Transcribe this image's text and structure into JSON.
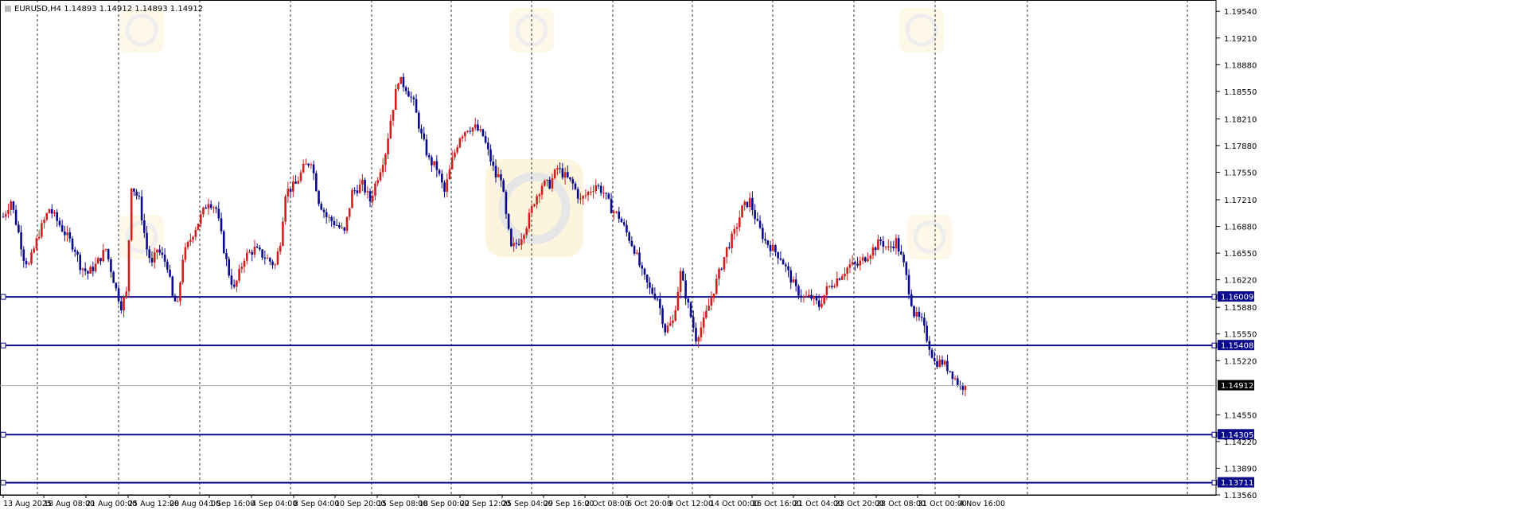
{
  "chart_data": {
    "type": "candlestick",
    "title": "EURUSD,H4  1.14893 1.14912 1.14893 1.14912",
    "last_price": 1.14912,
    "ylim": [
      1.1356,
      1.1968
    ],
    "y_ticks": [
      "1.19540",
      "1.19210",
      "1.18880",
      "1.18550",
      "1.18210",
      "1.17880",
      "1.17550",
      "1.17210",
      "1.16880",
      "1.16550",
      "1.16220",
      "1.15880",
      "1.15550",
      "1.15220",
      "1.14912",
      "1.14550",
      "1.14220",
      "1.13890",
      "1.13560"
    ],
    "x_labels": [
      "13 Aug 2025",
      "18 Aug 08:00",
      "21 Aug 00:00",
      "25 Aug 12:00",
      "28 Aug 04:00",
      "1 Sep 16:00",
      "4 Sep 04:00",
      "8 Sep 04:00",
      "10 Sep 20:00",
      "15 Sep 08:00",
      "18 Sep 00:00",
      "22 Sep 12:00",
      "25 Sep 04:00",
      "29 Sep 16:00",
      "2 Oct 08:00",
      "6 Oct 20:00",
      "9 Oct 12:00",
      "14 Oct 00:00",
      "16 Oct 16:00",
      "21 Oct 04:00",
      "23 Oct 20:00",
      "28 Oct 08:00",
      "31 Oct 00:00",
      "4 Nov 16:00"
    ],
    "horizontal_levels": [
      {
        "value": 1.16009,
        "label": "1.16009"
      },
      {
        "value": 1.15408,
        "label": "1.15408"
      },
      {
        "value": 1.14305,
        "label": "1.14305"
      },
      {
        "value": 1.13711,
        "label": "1.13711"
      }
    ],
    "price_path": [
      [
        0,
        1.17
      ],
      [
        3,
        1.172
      ],
      [
        6,
        1.168
      ],
      [
        8,
        1.165
      ],
      [
        10,
        1.164
      ],
      [
        14,
        1.168
      ],
      [
        18,
        1.171
      ],
      [
        20,
        1.17
      ],
      [
        24,
        1.168
      ],
      [
        28,
        1.166
      ],
      [
        30,
        1.164
      ],
      [
        33,
        1.163
      ],
      [
        36,
        1.164
      ],
      [
        40,
        1.166
      ],
      [
        44,
        1.161
      ],
      [
        46,
        1.159
      ],
      [
        48,
        1.1605
      ],
      [
        50,
        1.174
      ],
      [
        53,
        1.172
      ],
      [
        56,
        1.166
      ],
      [
        58,
        1.164
      ],
      [
        60,
        1.166
      ],
      [
        64,
        1.164
      ],
      [
        66,
        1.16
      ],
      [
        68,
        1.159
      ],
      [
        70,
        1.165
      ],
      [
        74,
        1.168
      ],
      [
        77,
        1.17
      ],
      [
        80,
        1.172
      ],
      [
        83,
        1.171
      ],
      [
        86,
        1.166
      ],
      [
        88,
        1.163
      ],
      [
        90,
        1.161
      ],
      [
        94,
        1.165
      ],
      [
        98,
        1.166
      ],
      [
        102,
        1.165
      ],
      [
        106,
        1.164
      ],
      [
        108,
        1.167
      ],
      [
        110,
        1.173
      ],
      [
        114,
        1.174
      ],
      [
        117,
        1.176
      ],
      [
        120,
        1.177
      ],
      [
        123,
        1.172
      ],
      [
        126,
        1.17
      ],
      [
        130,
        1.169
      ],
      [
        133,
        1.168
      ],
      [
        136,
        1.173
      ],
      [
        140,
        1.174
      ],
      [
        143,
        1.172
      ],
      [
        146,
        1.175
      ],
      [
        149,
        1.178
      ],
      [
        151,
        1.182
      ],
      [
        154,
        1.187
      ],
      [
        157,
        1.186
      ],
      [
        160,
        1.184
      ],
      [
        163,
        1.18
      ],
      [
        166,
        1.177
      ],
      [
        169,
        1.176
      ],
      [
        172,
        1.173
      ],
      [
        175,
        1.177
      ],
      [
        178,
        1.18
      ],
      [
        181,
        1.181
      ],
      [
        184,
        1.181
      ],
      [
        187,
        1.18
      ],
      [
        190,
        1.177
      ],
      [
        192,
        1.175
      ],
      [
        194,
        1.175
      ],
      [
        196,
        1.17
      ],
      [
        198,
        1.166
      ],
      [
        201,
        1.167
      ],
      [
        204,
        1.169
      ],
      [
        207,
        1.172
      ],
      [
        210,
        1.174
      ],
      [
        213,
        1.174
      ],
      [
        216,
        1.176
      ],
      [
        219,
        1.175
      ],
      [
        222,
        1.174
      ],
      [
        225,
        1.172
      ],
      [
        228,
        1.173
      ],
      [
        231,
        1.174
      ],
      [
        234,
        1.173
      ],
      [
        237,
        1.171
      ],
      [
        240,
        1.17
      ],
      [
        243,
        1.168
      ],
      [
        246,
        1.166
      ],
      [
        249,
        1.163
      ],
      [
        252,
        1.161
      ],
      [
        255,
        1.16
      ],
      [
        258,
        1.156
      ],
      [
        261,
        1.157
      ],
      [
        264,
        1.163
      ],
      [
        267,
        1.159
      ],
      [
        270,
        1.155
      ],
      [
        273,
        1.157
      ],
      [
        276,
        1.16
      ],
      [
        279,
        1.163
      ],
      [
        282,
        1.166
      ],
      [
        285,
        1.168
      ],
      [
        288,
        1.171
      ],
      [
        291,
        1.172
      ],
      [
        294,
        1.169
      ],
      [
        297,
        1.167
      ],
      [
        300,
        1.166
      ],
      [
        303,
        1.165
      ],
      [
        306,
        1.163
      ],
      [
        309,
        1.161
      ],
      [
        312,
        1.16
      ],
      [
        315,
        1.16
      ],
      [
        318,
        1.159
      ],
      [
        321,
        1.161
      ],
      [
        324,
        1.162
      ],
      [
        327,
        1.163
      ],
      [
        330,
        1.164
      ],
      [
        333,
        1.164
      ],
      [
        336,
        1.165
      ],
      [
        339,
        1.166
      ],
      [
        342,
        1.167
      ],
      [
        345,
        1.166
      ],
      [
        348,
        1.167
      ],
      [
        351,
        1.164
      ],
      [
        353,
        1.161
      ],
      [
        355,
        1.158
      ],
      [
        358,
        1.157
      ],
      [
        360,
        1.155
      ],
      [
        363,
        1.152
      ],
      [
        366,
        1.152
      ],
      [
        369,
        1.151
      ],
      [
        371,
        1.15
      ],
      [
        373,
        1.149
      ],
      [
        375,
        1.14912
      ]
    ]
  }
}
